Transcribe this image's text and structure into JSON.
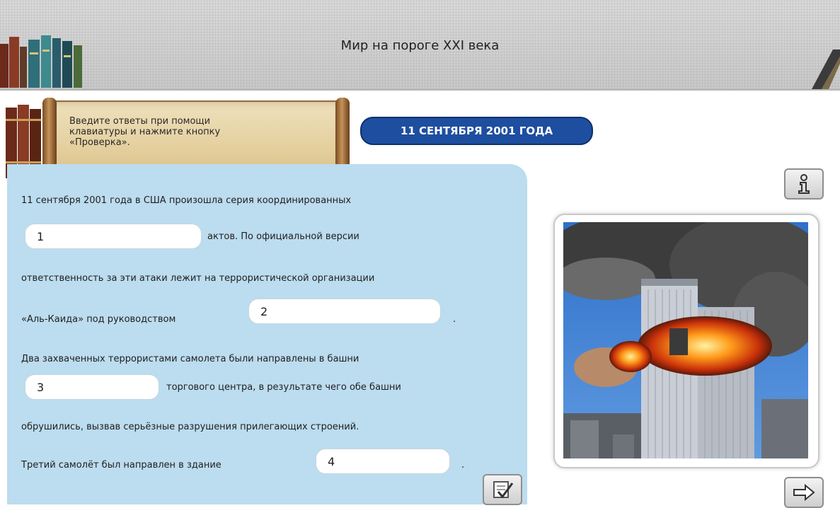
{
  "header": {
    "title": "Мир на пороге XXI века"
  },
  "instructions": {
    "text": "Введите ответы при помощи\nклавиатуры и нажмите кнопку\n«Проверка»."
  },
  "topic": {
    "label": "11 СЕНТЯБРЯ 2001 ГОДА"
  },
  "exercise": {
    "line1": "11 сентября 2001 года в США произошла серия координированных",
    "line2_after": "актов. По официальной версии",
    "line3": "ответственность за эти атаки лежит на террористической организации",
    "line4_before": "«Аль-Каида» под руководством",
    "line4_after": ".",
    "line5": "Два захваченных террористами самолета были направлены в башни",
    "line6_after": "торгового центра, в результате чего обе башни",
    "line7": "обрушились, вызвав серьёзные разрушения прилегающих строений.",
    "line8_before": "Третий самолёт был направлен в здание",
    "line8_after": ".",
    "answers": [
      "1",
      "2",
      "3",
      "4"
    ]
  },
  "buttons": {
    "info_icon": "info-icon",
    "check_icon": "check-icon",
    "next_icon": "arrow-right-icon"
  },
  "colors": {
    "panel": "#bcdcef",
    "pill": "#1e4ea0",
    "header": "#d0d0d0"
  }
}
